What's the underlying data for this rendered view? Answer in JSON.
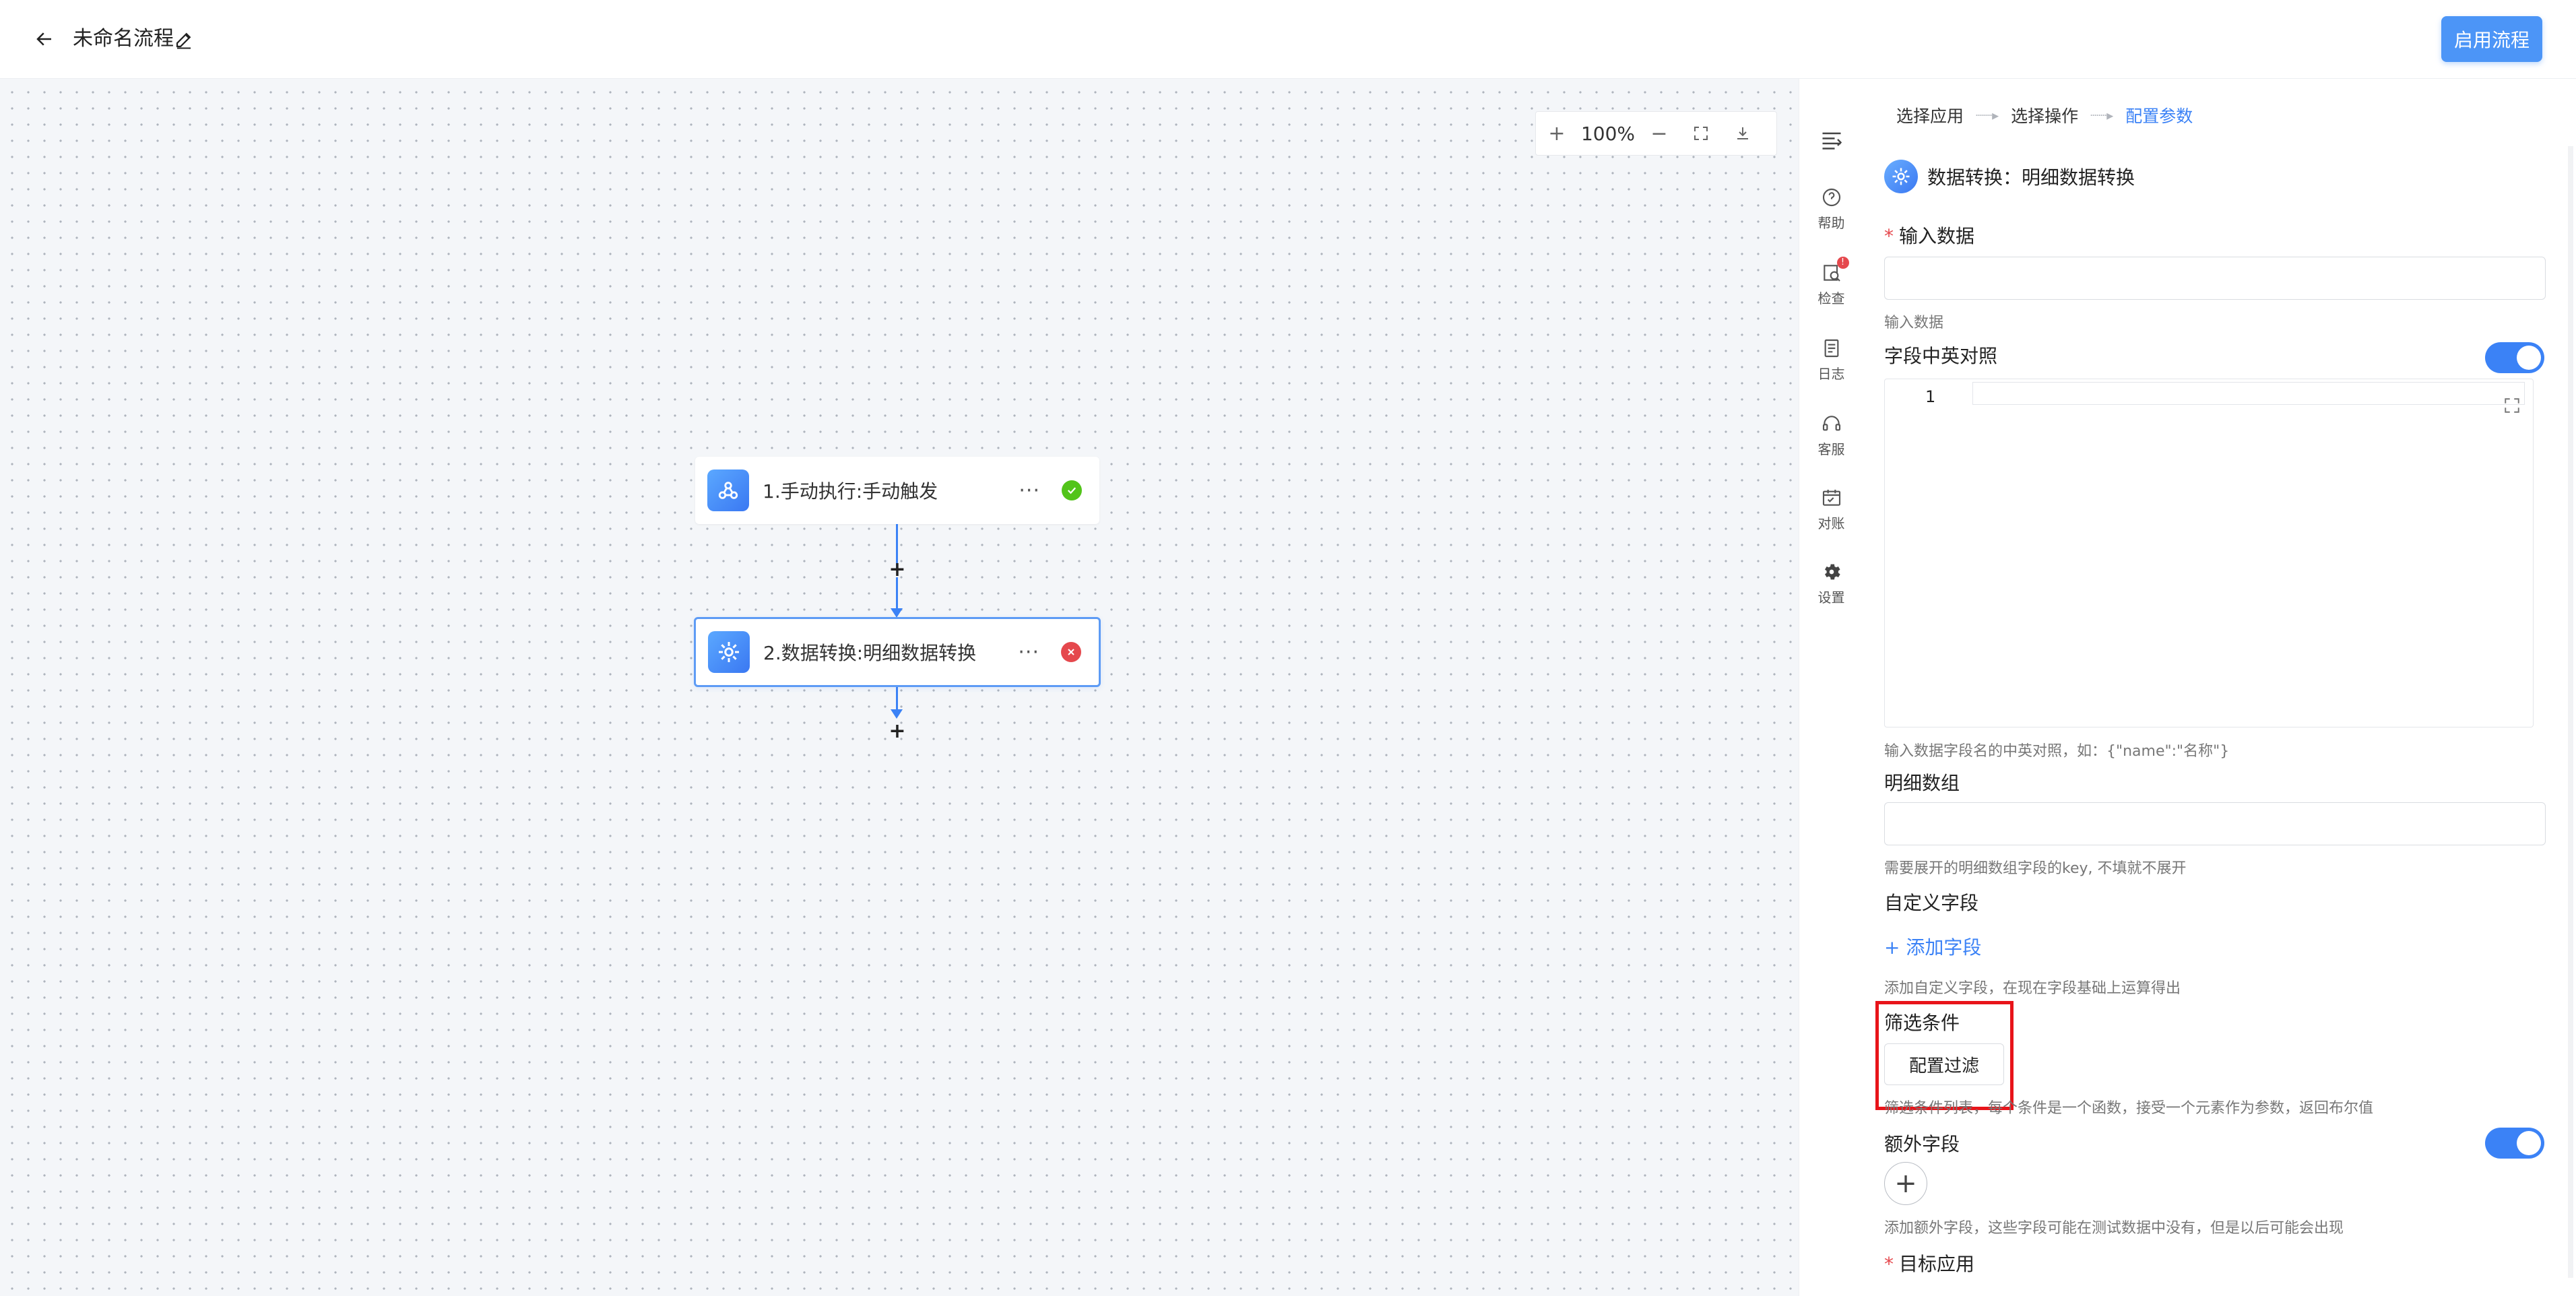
{
  "header": {
    "flow_title": "未命名流程",
    "enable_button": "启用流程"
  },
  "canvas": {
    "zoom_level": "100%",
    "zoom_in": "+",
    "zoom_out": "−",
    "nodes": [
      {
        "label": "1.手动执行:手动触发",
        "more": "···",
        "status": "success"
      },
      {
        "label": "2.数据转换:明细数据转换",
        "more": "···",
        "status": "error"
      }
    ],
    "add_symbol": "+"
  },
  "sidebar": {
    "items": [
      {
        "label": "",
        "icon": "collapse-menu-icon"
      },
      {
        "label": "帮助",
        "icon": "help-icon"
      },
      {
        "label": "检查",
        "icon": "check-icon",
        "badge": "!"
      },
      {
        "label": "日志",
        "icon": "log-icon"
      },
      {
        "label": "客服",
        "icon": "headset-icon"
      },
      {
        "label": "对账",
        "icon": "reconcile-icon"
      },
      {
        "label": "设置",
        "icon": "gear-icon"
      }
    ]
  },
  "panel": {
    "steps": [
      "选择应用",
      "选择操作",
      "配置参数"
    ],
    "active_step": 2,
    "config_title": "数据转换：明细数据转换",
    "input_data": {
      "label": "输入数据",
      "help": "输入数据",
      "value": ""
    },
    "field_map": {
      "label": "字段中英对照",
      "toggle": true,
      "line_no": "1",
      "help": "输入数据字段名的中英对照，如：{\"name\":\"名称\"}"
    },
    "detail_array": {
      "label": "明细数组",
      "value": "",
      "help": "需要展开的明细数组字段的key, 不填就不展开"
    },
    "custom_fields": {
      "label": "自定义字段",
      "add_link": "+ 添加字段",
      "help": "添加自定义字段，在现在字段基础上运算得出"
    },
    "filter": {
      "label": "筛选条件",
      "button": "配置过滤",
      "help": "筛选条件列表，每个条件是一个函数，接受一个元素作为参数，返回布尔值"
    },
    "extra_fields": {
      "label": "额外字段",
      "toggle": true,
      "add": "+",
      "help": "添加额外字段，这些字段可能在测试数据中没有，但是以后可能会出现"
    },
    "target_app": {
      "label": "目标应用"
    }
  },
  "colors": {
    "accent": "#3b82f6",
    "success": "#52c41a",
    "error": "#e5484d",
    "highlight": "#e8141a"
  }
}
